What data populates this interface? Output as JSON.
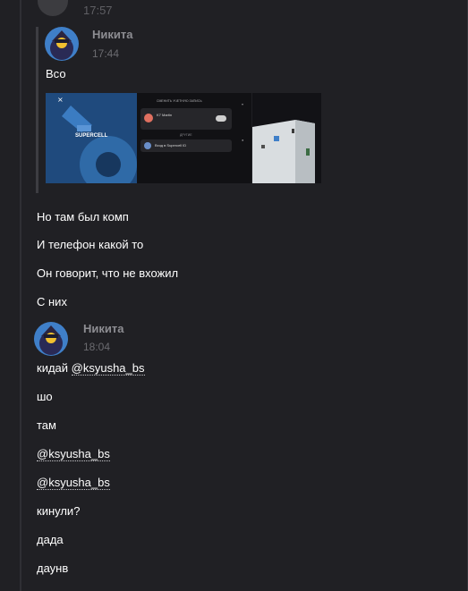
{
  "top": {
    "time": "17:57"
  },
  "quoted": {
    "author": "Никита",
    "time": "17:44",
    "text": "Всо",
    "attachments": [
      {
        "name": "supercell-id-login-screenshot",
        "label": "SUPERCELL"
      },
      {
        "name": "account-switch-screenshot",
        "header": "СМЕНИТЬ УЧЕТНУЮ ЗАПИСЬ",
        "account_name": "K7 Martin",
        "section": "ДРУГИЕ",
        "other_login": "Вход в Supercell ID"
      },
      {
        "name": "computer-room-photo"
      }
    ]
  },
  "messages": [
    {
      "text": "Но там был комп"
    },
    {
      "text": "И телефон какой то"
    },
    {
      "text": "Он говорит, что не вхожил"
    },
    {
      "text": "С них"
    }
  ],
  "second": {
    "author": "Никита",
    "time": "18:04",
    "first_prefix": "кидай ",
    "first_mention": "@ksyusha_bs",
    "lines": [
      {
        "text": "шо"
      },
      {
        "text": "там"
      },
      {
        "mention": "@ksyusha_bs"
      },
      {
        "mention": "@ksyusha_bs"
      },
      {
        "text": "кинули?"
      },
      {
        "text": "дада"
      },
      {
        "text": "даунв"
      }
    ]
  }
}
